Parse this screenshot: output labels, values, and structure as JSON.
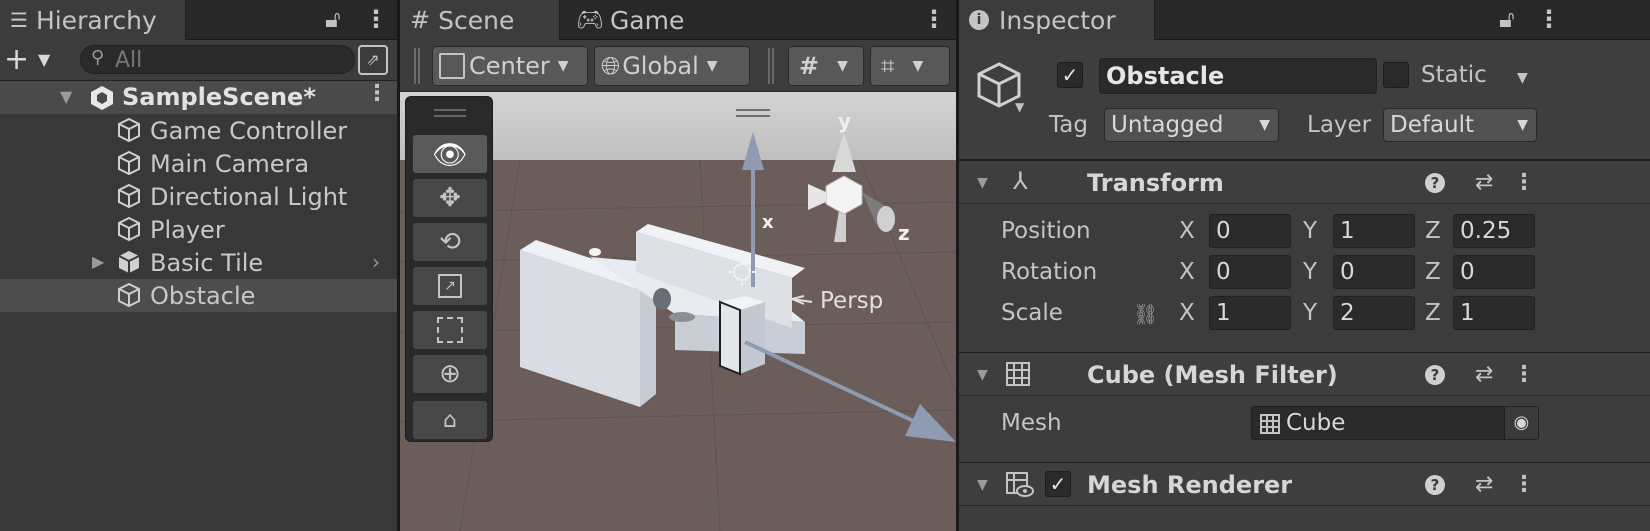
{
  "hierarchy": {
    "tab_label": "Hierarchy",
    "search_placeholder": "All",
    "scene_name": "SampleScene*",
    "items": [
      {
        "label": "Game Controller"
      },
      {
        "label": "Main Camera"
      },
      {
        "label": "Directional Light"
      },
      {
        "label": "Player"
      },
      {
        "label": "Basic Tile"
      },
      {
        "label": "Obstacle"
      }
    ]
  },
  "scene_view": {
    "tabs": [
      {
        "label": "Scene"
      },
      {
        "label": "Game"
      }
    ],
    "pivot_mode": "Center",
    "pivot_rotation": "Global",
    "projection_label": "Persp",
    "gizmo_axes": {
      "y": "y",
      "x": "x",
      "z": "z"
    }
  },
  "inspector": {
    "tab_label": "Inspector",
    "object_name": "Obstacle",
    "active": true,
    "static_label": "Static",
    "tag_label": "Tag",
    "tag_value": "Untagged",
    "layer_label": "Layer",
    "layer_value": "Default",
    "transform": {
      "title": "Transform",
      "rows": [
        {
          "label": "Position",
          "x": "0",
          "y": "1",
          "z": "0.25"
        },
        {
          "label": "Rotation",
          "x": "0",
          "y": "0",
          "z": "0"
        },
        {
          "label": "Scale",
          "x": "1",
          "y": "2",
          "z": "1"
        }
      ],
      "axis_x": "X",
      "axis_y": "Y",
      "axis_z": "Z"
    },
    "mesh_filter": {
      "title": "Cube (Mesh Filter)",
      "mesh_label": "Mesh",
      "mesh_value": "Cube"
    },
    "mesh_renderer": {
      "title": "Mesh Renderer",
      "enabled": true
    }
  },
  "colors": {
    "panel_bg": "#383838",
    "selected_row": "#4d4d4d",
    "field_bg": "#2a2a2a",
    "ground": "#6b5d5a",
    "sky": "#c9c9c9"
  }
}
